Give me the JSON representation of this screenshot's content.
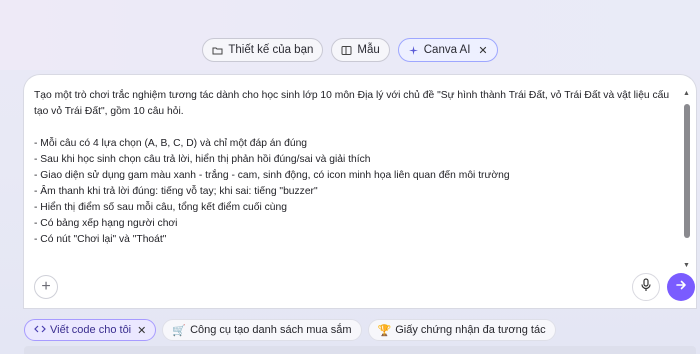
{
  "top_tabs": [
    {
      "label": "Thiết kế của bạn",
      "icon": "folder-icon"
    },
    {
      "label": "Mẫu",
      "icon": "template-icon"
    },
    {
      "label": "Canva AI",
      "icon": "sparkle-icon",
      "close": "✕"
    }
  ],
  "prompt": {
    "text": "Tạo một trò chơi trắc nghiệm tương tác dành cho học sinh lớp 10 môn Địa lý với chủ đề \"Sự hình thành Trái Đất, vỏ Trái Đất và vật liệu cấu tạo vỏ Trái Đất\", gồm 10 câu hỏi.\n\n- Mỗi câu có 4 lựa chọn (A, B, C, D) và chỉ một đáp án đúng\n- Sau khi học sinh chọn câu trả lời, hiển thị phản hồi đúng/sai và giải thích\n- Giao diện sử dụng gam màu xanh - trắng - cam, sinh động, có icon minh họa liên quan đến môi trường\n- Âm thanh khi trả lời đúng: tiếng vỗ tay; khi sai: tiếng \"buzzer\"\n- Hiển thị điểm số sau mỗi câu, tổng kết điểm cuối cùng\n- Có bảng xếp hạng người chơi\n- Có nút \"Chơi lại\" và \"Thoát\""
  },
  "controls": {
    "add": "+",
    "scroll_up": "▲",
    "scroll_down": "▼"
  },
  "suggestions": [
    {
      "label": "Viết code cho tôi",
      "icon": "code-icon",
      "close": "✕"
    },
    {
      "label": "Công cụ tạo danh sách mua sắm",
      "icon": "cart-icon",
      "emoji": "🛒"
    },
    {
      "label": "Giấy chứng nhận đa tương tác",
      "icon": "trophy-icon",
      "emoji": "🏆"
    }
  ],
  "colors": {
    "accent": "#7a5cff",
    "active_border": "#9ea7ff"
  }
}
